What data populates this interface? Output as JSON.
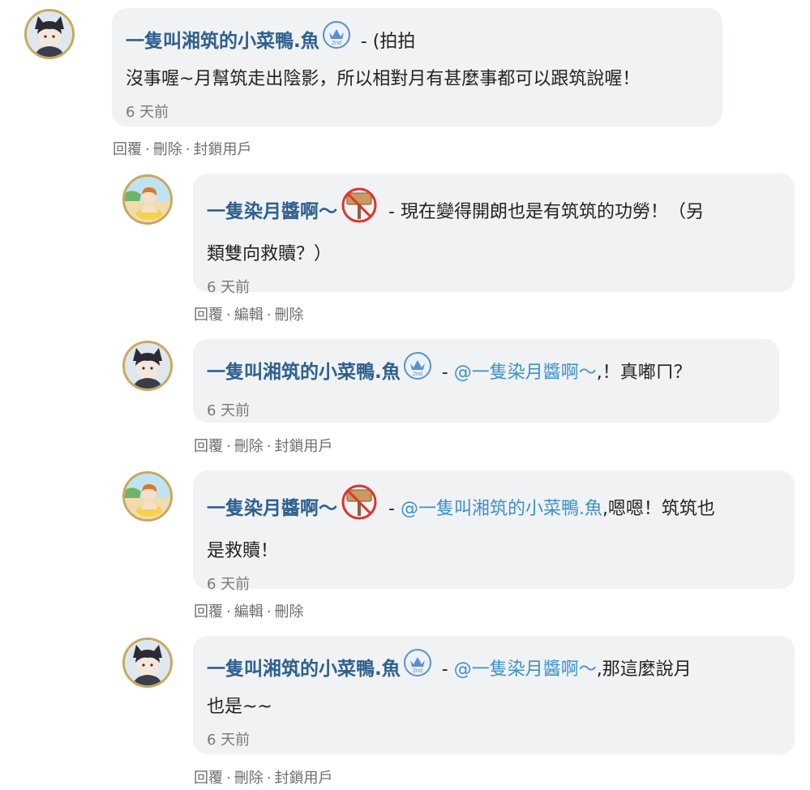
{
  "comments": [
    {
      "author": "一隻叫湘筑的小菜鴨.魚",
      "badge": "crown-2nd",
      "mention": "",
      "line1": "(拍拍",
      "line2": "沒事喔~月幫筑走出陰影，所以相對月有甚麼事都可以跟筑說喔！",
      "time": "6 天前",
      "actions": [
        "回覆",
        "刪除",
        "封鎖用戶"
      ]
    },
    {
      "author": "一隻染月醬啊～",
      "badge": "sign-no",
      "mention": "",
      "line1": "現在變得開朗也是有筑筑的功勞！（另",
      "line2": "類雙向救贖？）",
      "time": "6 天前",
      "actions": [
        "回覆",
        "編輯",
        "刪除"
      ]
    },
    {
      "author": "一隻叫湘筑的小菜鴨.魚",
      "badge": "crown-2nd",
      "mention": "@一隻染月醬啊～",
      "line1": ",！真嘟ㄇ？",
      "line2": "",
      "time": "6 天前",
      "actions": [
        "回覆",
        "刪除",
        "封鎖用戶"
      ]
    },
    {
      "author": "一隻染月醬啊～",
      "badge": "sign-no",
      "mention": "@一隻叫湘筑的小菜鴨.魚",
      "line1": ",嗯嗯！筑筑也",
      "line2": "是救贖！",
      "time": "6 天前",
      "actions": [
        "回覆",
        "編輯",
        "刪除"
      ]
    },
    {
      "author": "一隻叫湘筑的小菜鴨.魚",
      "badge": "crown-2nd",
      "mention": "@一隻染月醬啊～",
      "line1": ",那這麼說月",
      "line2": "也是~~",
      "time": "6 天前",
      "actions": [
        "回覆",
        "刪除",
        "封鎖用戶"
      ]
    }
  ],
  "badge_text": "2nd",
  "colors": {
    "author": "#2e6090",
    "mention": "#3b91cf",
    "bubble": "#f1f2f3",
    "avatar_ring": "#c9a85d"
  }
}
